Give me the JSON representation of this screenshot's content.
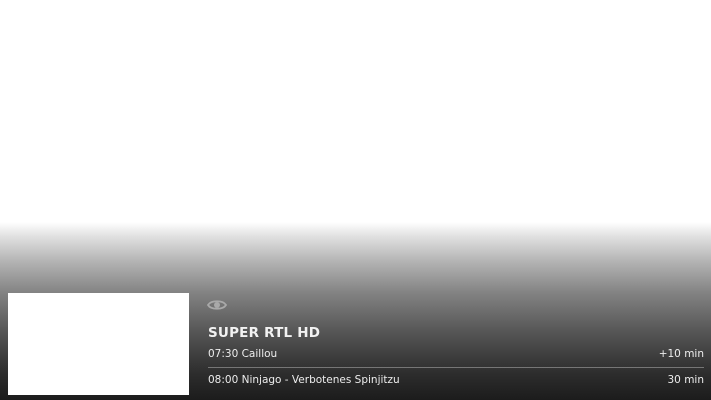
{
  "icons": {
    "watch_indicator": "eye-icon"
  },
  "channel": {
    "name": "SUPER RTL HD"
  },
  "programs": [
    {
      "time_title": "07:30 Caillou",
      "duration": "+10 min"
    },
    {
      "time_title": "08:00 Ninjago - Verbotenes Spinjitzu",
      "duration": "30 min"
    }
  ]
}
